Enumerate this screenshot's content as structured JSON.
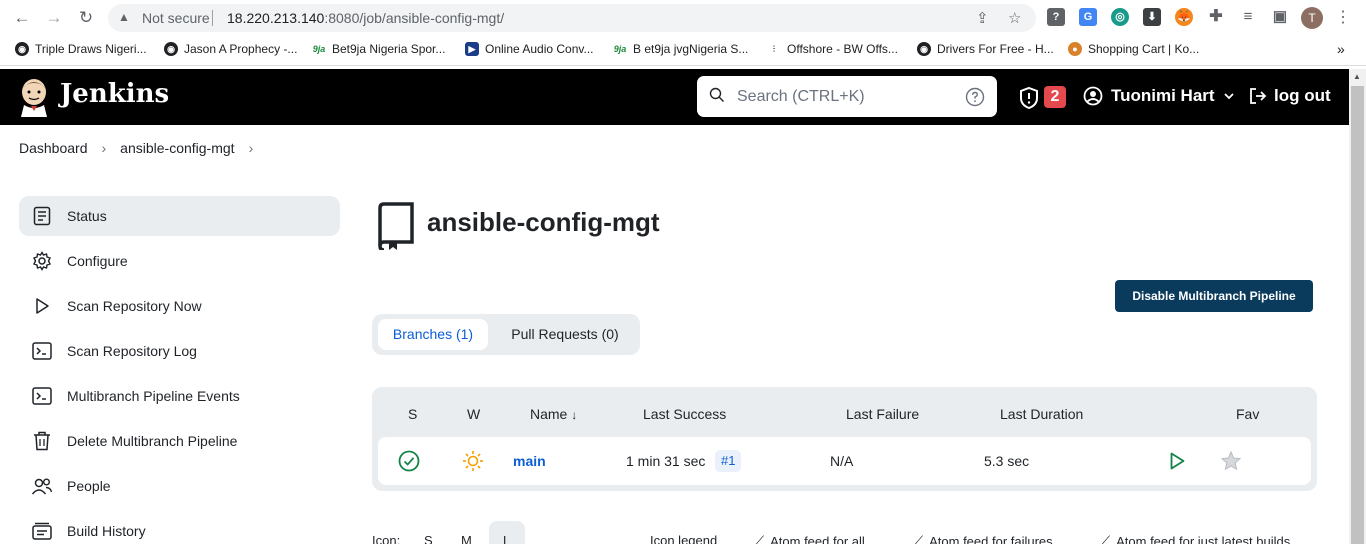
{
  "browser": {
    "security_label": "Not secure",
    "url_host": "18.220.213.140",
    "url_rest": ":8080/job/ansible-config-mgt/",
    "profile_initial": "T",
    "bookmarks": [
      {
        "label": "Triple Draws Nigeri...",
        "icon": "globe-icon"
      },
      {
        "label": "Jason A Prophecy -...",
        "icon": "globe-icon"
      },
      {
        "label": "Bet9ja Nigeria Spor...",
        "icon": "9ja",
        "color": "#1a8a3a"
      },
      {
        "label": "Online Audio Conv...",
        "icon": "play-icon",
        "color": "#1a3c8a"
      },
      {
        "label": "B et9ja jvgNigeria S...",
        "icon": "9ja",
        "color": "#1a8a3a"
      },
      {
        "label": "Offshore - BW Offs...",
        "icon": "offshore-icon"
      },
      {
        "label": "Drivers For Free - H...",
        "icon": "globe-icon"
      },
      {
        "label": "Shopping Cart | Ko...",
        "icon": "coin-icon",
        "color": "#d9822b"
      }
    ]
  },
  "header": {
    "brand": "Jenkins",
    "search_placeholder": "Search (CTRL+K)",
    "security_count": "2",
    "user_name": "Tuonimi Hart",
    "logout_label": "log out"
  },
  "breadcrumb": [
    "Dashboard",
    "ansible-config-mgt"
  ],
  "sidebar": {
    "items": [
      {
        "label": "Status",
        "icon": "status-icon",
        "active": true
      },
      {
        "label": "Configure",
        "icon": "gear-icon"
      },
      {
        "label": "Scan Repository Now",
        "icon": "play-icon"
      },
      {
        "label": "Scan Repository Log",
        "icon": "terminal-icon"
      },
      {
        "label": "Multibranch Pipeline Events",
        "icon": "terminal-icon"
      },
      {
        "label": "Delete Multibranch Pipeline",
        "icon": "trash-icon"
      },
      {
        "label": "People",
        "icon": "people-icon"
      },
      {
        "label": "Build History",
        "icon": "history-icon"
      }
    ]
  },
  "main": {
    "title": "ansible-config-mgt",
    "disable_button": "Disable Multibranch Pipeline",
    "tabs": [
      {
        "label": "Branches (1)",
        "active": true
      },
      {
        "label": "Pull Requests (0)",
        "active": false
      }
    ],
    "table": {
      "headers": {
        "s": "S",
        "w": "W",
        "name": "Name",
        "sort": "↓",
        "last_success": "Last Success",
        "last_failure": "Last Failure",
        "last_duration": "Last Duration",
        "fav": "Fav"
      },
      "rows": [
        {
          "name": "main",
          "last_success": "1 min 31 sec",
          "build": "#1",
          "last_failure": "N/A",
          "last_duration": "5.3 sec",
          "status": "success",
          "weather": "sunny"
        }
      ]
    },
    "footer": {
      "icon_label": "Icon:",
      "sizes": [
        "S",
        "M",
        "L"
      ],
      "legend": "Icon legend",
      "feeds": [
        "Atom feed for all",
        "Atom feed for failures",
        "Atom feed for just latest builds"
      ]
    }
  },
  "colors": {
    "accent": "#0b5ed7",
    "success": "#138347",
    "header_bg": "#000000",
    "danger": "#e5484d"
  }
}
